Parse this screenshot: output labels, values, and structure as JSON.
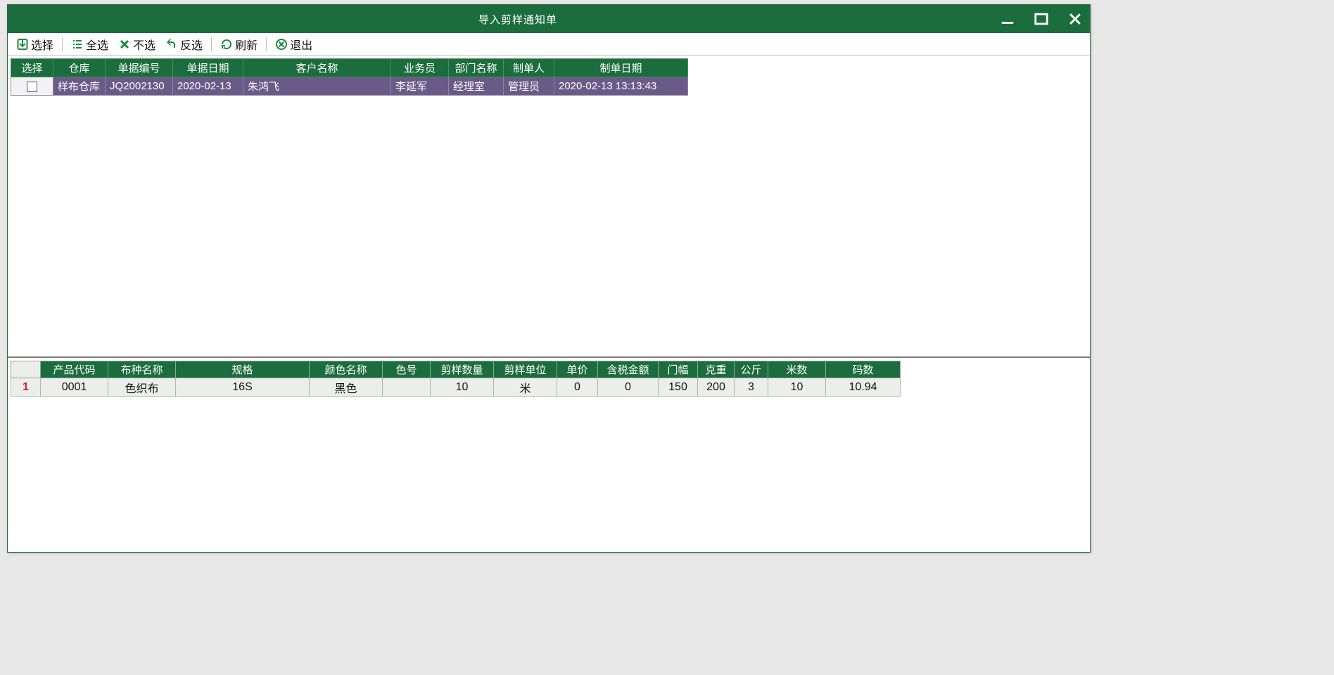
{
  "titlebar": {
    "title": "导入剪样通知单"
  },
  "toolbar": {
    "select": "选择",
    "select_all": "全选",
    "deselect": "不选",
    "invert": "反选",
    "refresh": "刷新",
    "exit": "退出"
  },
  "upper": {
    "columns": [
      "选择",
      "仓库",
      "单据编号",
      "单据日期",
      "客户名称",
      "业务员",
      "部门名称",
      "制单人",
      "制单日期"
    ],
    "rows": [
      {
        "checked": false,
        "warehouse": "样布仓库",
        "doc_no": "JQ2002130",
        "doc_date": "2020-02-13",
        "customer": "朱鸿飞",
        "salesman": "李延军",
        "department": "经理室",
        "creator": "管理员",
        "create_time": "2020-02-13 13:13:43"
      }
    ]
  },
  "lower": {
    "columns": [
      "",
      "产品代码",
      "布种名称",
      "规格",
      "颜色名称",
      "色号",
      "剪样数量",
      "剪样单位",
      "单价",
      "含税金额",
      "门幅",
      "克重",
      "公斤",
      "米数",
      "码数"
    ],
    "rows": [
      {
        "rownum": "1",
        "product_code": "0001",
        "fabric_name": "色织布",
        "spec": "16S",
        "color_name": "黑色",
        "color_no": "",
        "qty": "10",
        "unit": "米",
        "price": "0",
        "tax_amount": "0",
        "width": "150",
        "weight": "200",
        "kg": "3",
        "meters": "10",
        "yards": "10.94"
      }
    ]
  }
}
